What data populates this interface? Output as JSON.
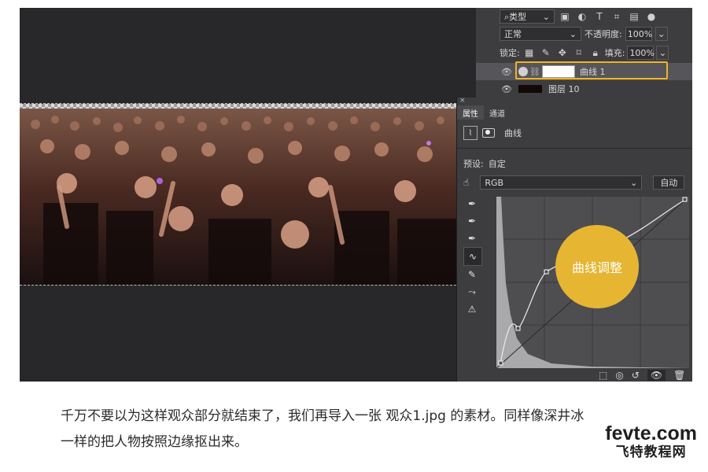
{
  "layers_panel": {
    "filter_kind": "类型",
    "blend_mode": "正常",
    "opacity_label": "不透明度:",
    "opacity_value": "100%",
    "lock_label": "锁定:",
    "fill_label": "填充:",
    "fill_value": "100%",
    "layers": [
      {
        "name": "曲线 1",
        "selected": true
      },
      {
        "name": "图层 10",
        "selected": false
      }
    ]
  },
  "properties_panel": {
    "tabs": [
      "属性",
      "通道"
    ],
    "adjustment_title": "曲线",
    "preset_label": "预设:",
    "preset_value": "自定",
    "channel_value": "RGB",
    "auto_button": "自动",
    "icons": [
      "eyedropper-black-icon",
      "eyedropper-gray-icon",
      "eyedropper-white-icon",
      "curve-point-icon",
      "pencil-icon",
      "smooth-icon",
      "warning-icon"
    ]
  },
  "callout": {
    "text": "曲线调整",
    "color": "#e6b532"
  },
  "highlight_color": "#f0b323",
  "article": {
    "line1": "千万不要以为这样观众部分就结束了，我们再导入一张 观众1.jpg 的素材。同样像深井冰",
    "line2": "一样的把人物按照边缘抠出来。"
  },
  "watermark": {
    "top": "fevte.com",
    "bottom": "飞特教程网"
  }
}
